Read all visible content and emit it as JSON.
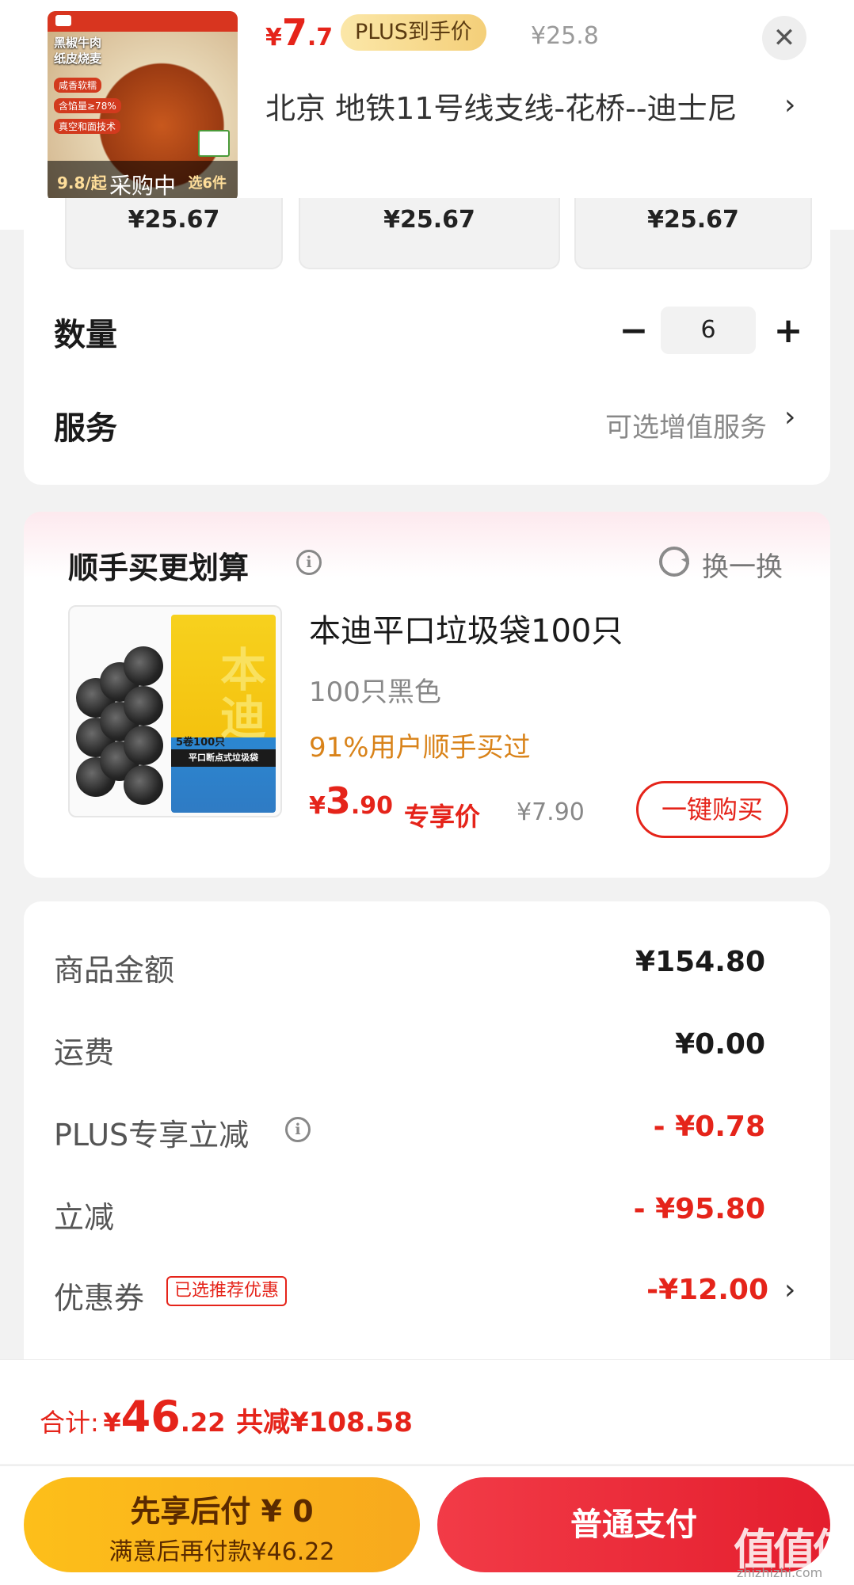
{
  "header": {
    "product_image": {
      "brand_strip": "",
      "title": "黑椒牛肉\n纸皮烧麦",
      "tags": [
        "咸香软糯",
        "含馅量≥78%",
        "真空和面技术"
      ],
      "band_price": "9.8/起",
      "band_label": "采购中",
      "band_pick": "选6件"
    },
    "price_currency": "¥",
    "price_int": "7",
    "price_dec": ".7",
    "plus_label": "PLUS到手价",
    "original_price": "¥25.8",
    "address": "北京  地铁11号线支线-花桥--迪士尼",
    "close_icon": "close-icon"
  },
  "spec_cards": [
    "¥25.67",
    "¥25.67",
    "¥25.67"
  ],
  "quantity": {
    "label": "数量",
    "minus": "−",
    "value": "6",
    "plus": "+"
  },
  "service": {
    "label": "服务",
    "value": "可选增值服务",
    "chevron": "›"
  },
  "recommend": {
    "title": "顺手买更划算",
    "swap_label": "换一换",
    "product": {
      "title": "本迪平口垃圾袋100只",
      "spec": "100只黑色",
      "bought": "91%用户顺手买过",
      "price_currency": "¥",
      "price_int": "3",
      "price_dec": ".90",
      "exclusive_label": "专享价",
      "original_price": "¥7.90",
      "buy_button": "一键购买",
      "image": {
        "pack_big": "本迪",
        "pack_num": "5卷100只",
        "pack_stripe": "平口断点式垃圾袋"
      }
    }
  },
  "summary": {
    "rows": [
      {
        "label": "商品金额",
        "value": "¥154.80",
        "red": false
      },
      {
        "label": "运费",
        "value": "¥0.00",
        "red": false
      },
      {
        "label": "PLUS专享立减",
        "value": "- ¥0.78",
        "red": true
      },
      {
        "label": "立减",
        "value": "- ¥95.80",
        "red": true
      },
      {
        "label": "优惠券",
        "value": "-¥12.00",
        "red": true
      }
    ],
    "coupon_tag": "已选推荐优惠"
  },
  "footer": {
    "total_label": "合计:",
    "total_currency": "¥",
    "total_int": "46",
    "total_dec": ".22",
    "saved": "共减¥108.58",
    "pay_later_line1": "先享后付 ¥ 0",
    "pay_later_line2": "满意后再付款¥46.22",
    "pay_normal": "普通支付"
  },
  "watermark": {
    "text": "值值值",
    "sub": "zhizhizhi.com"
  },
  "colors": {
    "accent_red": "#e5241a",
    "gold": "#f4cf79",
    "orange_text": "#d9831a",
    "pay_red": "#e41e2e",
    "pay_yellow": "#fdbf1a"
  }
}
